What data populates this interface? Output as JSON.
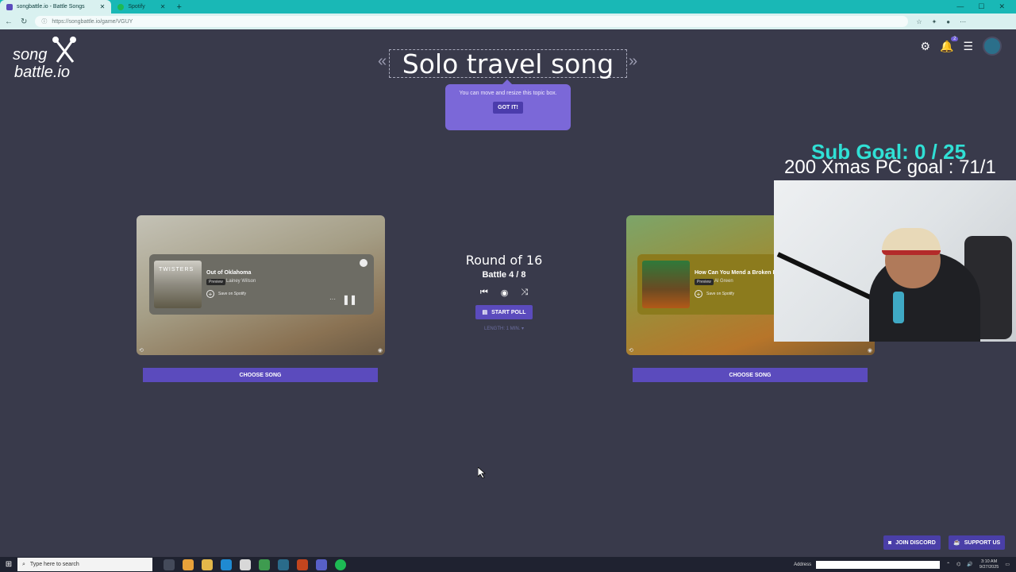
{
  "browser": {
    "tabs": [
      {
        "label": "songbattle.io - Battle Songs",
        "active": true
      },
      {
        "label": "Spotify",
        "active": false
      }
    ],
    "url": "https://songbattle.io/game/VGUY"
  },
  "logo": {
    "line1": "song",
    "line2": "battle.io"
  },
  "header": {
    "notification_count": "2"
  },
  "topic": {
    "title": "Solo travel song"
  },
  "tooltip": {
    "message": "You can move and resize this topic box.",
    "button": "GOT IT!"
  },
  "left_song": {
    "album_text": "TWISTERS",
    "title": "Out of Oklahoma",
    "badge": "Preview",
    "artist": "Lainey Wilson",
    "save": "Save on Spotify",
    "choose_label": "CHOOSE SONG"
  },
  "right_song": {
    "title": "How Can You Mend a Broken He",
    "badge": "Preview",
    "artist": "Al Green",
    "save": "Save on Spotify",
    "choose_label": "CHOOSE SONG"
  },
  "center": {
    "round": "Round of 16",
    "battle": "Battle 4 / 8",
    "start_poll": "START POLL",
    "length": "LENGTH: 1 MIN. ▾"
  },
  "overlay": {
    "sub_goal": "Sub Goal:  0 / 25",
    "xmas_goal": "200 Xmas PC goal : 71/1"
  },
  "footer": {
    "discord": "JOIN DISCORD",
    "support": "SUPPORT US"
  },
  "taskbar": {
    "search_placeholder": "Type here to search",
    "address_label": "Address",
    "time": "3:10 AM",
    "date": "9/27/2025"
  },
  "colors": {
    "page_bg": "#393a4b",
    "accent": "#5b4bbd",
    "tooltip": "#7b68d8",
    "browser_chrome": "#19b8b6",
    "overlay_goal": "#30e0d5"
  }
}
